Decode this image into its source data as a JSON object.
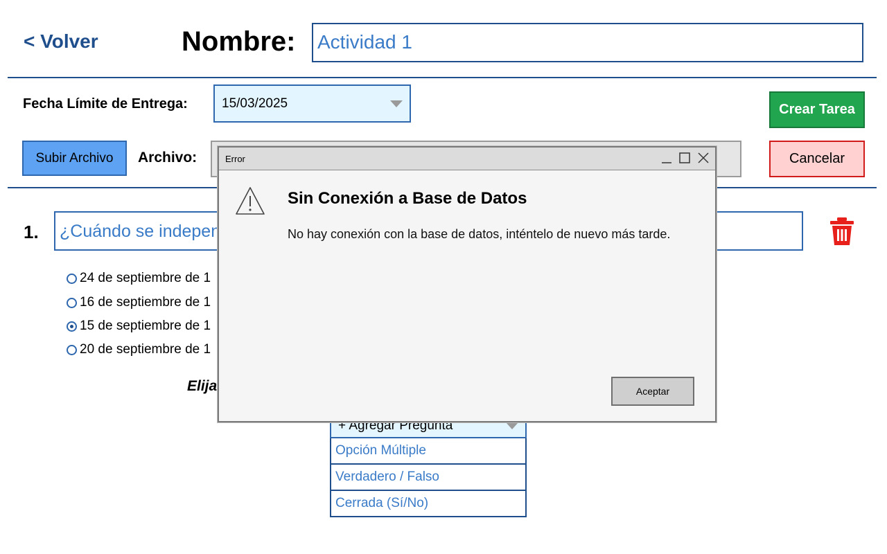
{
  "header": {
    "back_label": "< Volver",
    "name_label": "Nombre:",
    "name_value": "Actividad 1"
  },
  "form": {
    "date_label": "Fecha Límite de Entrega:",
    "date_value": "15/03/2025",
    "create_label": "Crear Tarea",
    "upload_label": "Subir Archivo",
    "file_label": "Archivo:",
    "cancel_label": "Cancelar"
  },
  "question": {
    "number": "1.",
    "text": "¿Cuándo se indepen",
    "options": [
      {
        "label": "24 de septiembre de 1",
        "selected": false
      },
      {
        "label": "16 de septiembre de 1",
        "selected": false
      },
      {
        "label": "15 de septiembre de 1",
        "selected": true
      },
      {
        "label": "20 de septiembre de 1",
        "selected": false
      }
    ]
  },
  "add_question": {
    "choose_label": "Elija",
    "select_label": "+ Agregar Pregunta",
    "items": [
      "Opción Múltiple",
      "Verdadero / Falso",
      "Cerrada (Sí/No)"
    ]
  },
  "dialog": {
    "title": "Error",
    "heading": "Sin Conexión a Base de Datos",
    "message": "No hay conexión con la base de datos, inténtelo de nuevo más tarde.",
    "accept_label": "Aceptar"
  },
  "colors": {
    "accent": "#1f4e8c",
    "create": "#21a54f",
    "cancel_border": "#d11a1a",
    "trash": "#e8201c"
  }
}
